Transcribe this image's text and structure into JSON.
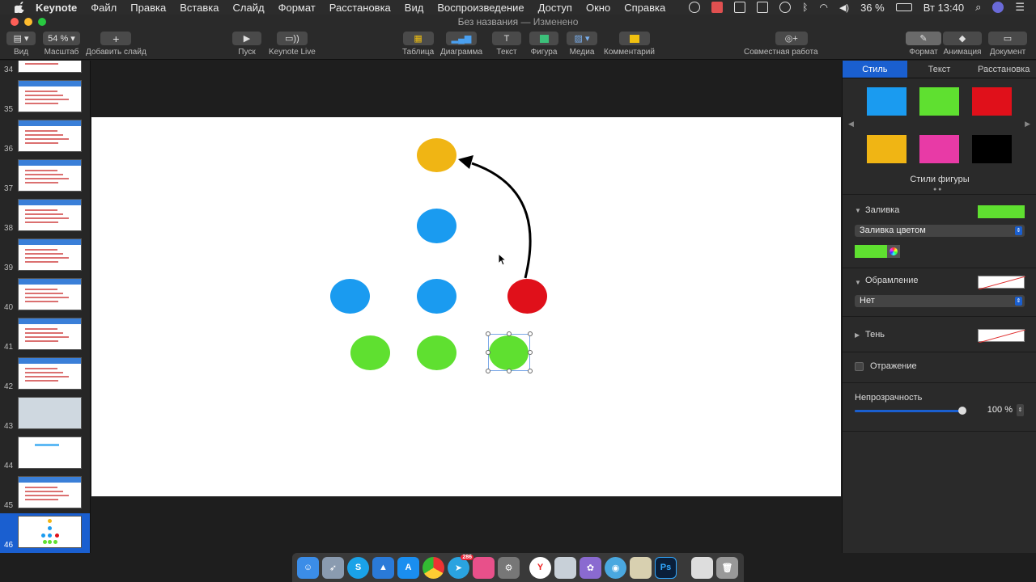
{
  "menubar": {
    "app_name": "Keynote",
    "items": [
      "Файл",
      "Правка",
      "Вставка",
      "Слайд",
      "Формат",
      "Расстановка",
      "Вид",
      "Воспроизведение",
      "Доступ",
      "Окно",
      "Справка"
    ],
    "battery": "36 %",
    "clock": "Вт 13:40"
  },
  "window": {
    "title": "Без названия",
    "title_suffix": "— Изменено"
  },
  "toolbar": {
    "view_label": "Вид",
    "zoom_value": "54 %",
    "zoom_label": "Масштаб",
    "add_slide_label": "Добавить слайд",
    "play_label": "Пуск",
    "keynote_live_label": "Keynote Live",
    "table_label": "Таблица",
    "chart_label": "Диаграмма",
    "text_label": "Текст",
    "shape_label": "Фигура",
    "media_label": "Медиа",
    "comment_label": "Комментарий",
    "collab_label": "Совместная работа",
    "format_label": "Формат",
    "animate_label": "Анимация",
    "document_label": "Документ"
  },
  "navigator": {
    "slides": [
      {
        "num": "34"
      },
      {
        "num": "35"
      },
      {
        "num": "36"
      },
      {
        "num": "37"
      },
      {
        "num": "38"
      },
      {
        "num": "39"
      },
      {
        "num": "40"
      },
      {
        "num": "41"
      },
      {
        "num": "42"
      },
      {
        "num": "43"
      },
      {
        "num": "44"
      },
      {
        "num": "45"
      },
      {
        "num": "46"
      }
    ],
    "selected": "46"
  },
  "slide_shapes": {
    "colors": {
      "yellow": "#f0b514",
      "blue": "#1a9bf0",
      "red": "#e0101a",
      "green": "#5fe030"
    }
  },
  "inspector": {
    "tabs": [
      "Стиль",
      "Текст",
      "Расстановка"
    ],
    "active_tab": "Стиль",
    "swatch_colors": [
      "#1a9bf0",
      "#5fe030",
      "#e0101a",
      "#f0b514",
      "#e83aa6",
      "#000000"
    ],
    "shape_styles_label": "Стили фигуры",
    "fill_label": "Заливка",
    "fill_color": "#5fe030",
    "fill_type": "Заливка цветом",
    "border_label": "Обрамление",
    "border_value": "Нет",
    "shadow_label": "Тень",
    "reflection_label": "Отражение",
    "opacity_label": "Непрозрачность",
    "opacity_value": "100 %",
    "opacity_level": 1.0
  },
  "dock": {
    "icons": [
      "finder-icon",
      "launchpad-icon",
      "skype-icon",
      "keynote-icon",
      "appstore-icon",
      "chrome-icon",
      "telegram-icon",
      "folder-icon",
      "preferences-icon",
      "yandex-icon",
      "preview-icon",
      "photobooth-icon",
      "screenshot-icon",
      "notes-icon",
      "photoshop-icon",
      "documents-icon",
      "trash-icon"
    ],
    "telegram_badge": "286",
    "photoshop_label": "Ps",
    "skype_label": "S",
    "yandex_label": "Y"
  }
}
